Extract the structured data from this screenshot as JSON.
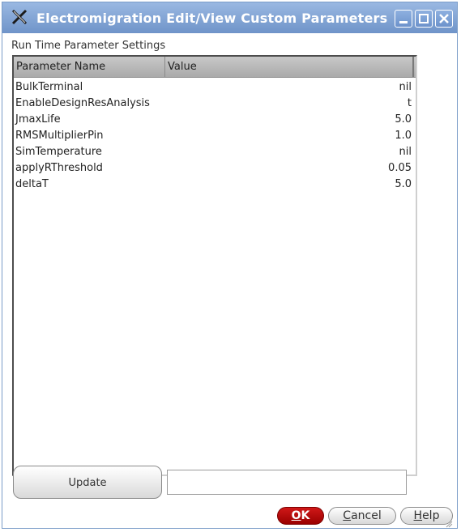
{
  "window": {
    "title": "Electromigration Edit/View Custom Parameters"
  },
  "section": {
    "label": "Run Time Parameter Settings"
  },
  "table": {
    "columns": [
      "Parameter Name",
      "Value"
    ],
    "rows": [
      {
        "name": "BulkTerminal",
        "value": "nil"
      },
      {
        "name": "EnableDesignResAnalysis",
        "value": "t"
      },
      {
        "name": "JmaxLife",
        "value": "5.0"
      },
      {
        "name": "RMSMultiplierPin",
        "value": "1.0"
      },
      {
        "name": "SimTemperature",
        "value": "nil"
      },
      {
        "name": "applyRThreshold",
        "value": "0.05"
      },
      {
        "name": "deltaT",
        "value": "5.0"
      }
    ]
  },
  "update": {
    "button_label": "Update",
    "field_value": ""
  },
  "buttons": {
    "ok": {
      "underlined": "O",
      "rest": "K"
    },
    "cancel": {
      "underlined": "C",
      "rest": "ancel"
    },
    "help": {
      "underlined": "H",
      "rest": "elp"
    }
  },
  "colors": {
    "titlebar": "#7fa2d4",
    "ok_button": "#c00000"
  },
  "icons": {
    "app": "tools-x-icon",
    "minimize": "minimize-icon",
    "maximize": "maximize-icon",
    "close": "close-icon"
  }
}
